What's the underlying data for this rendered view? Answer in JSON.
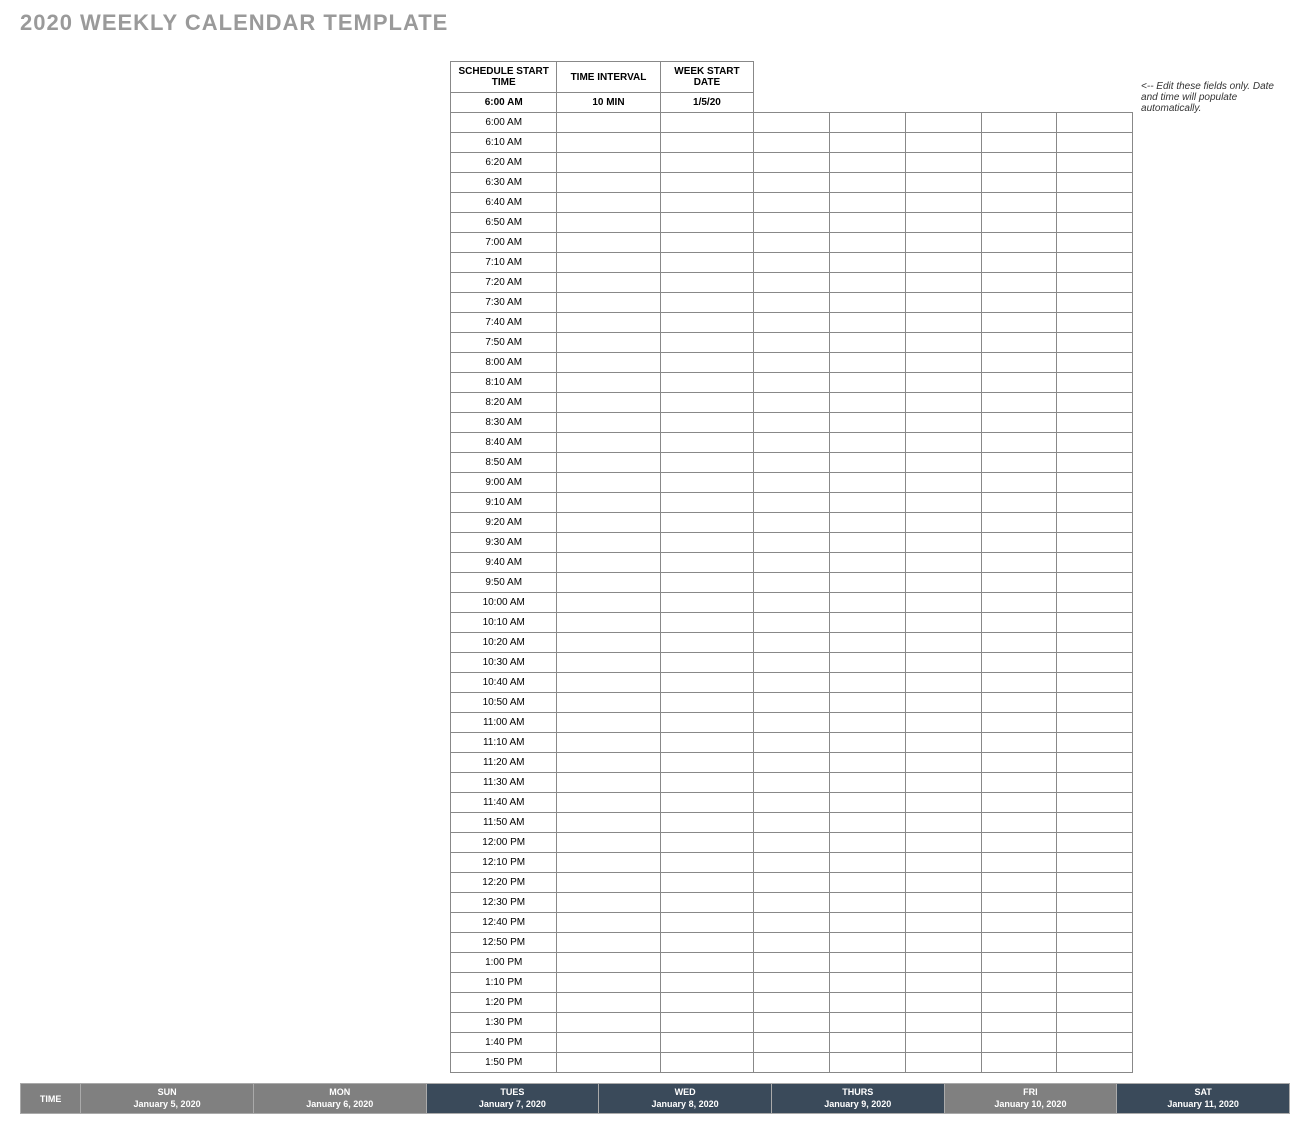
{
  "title": "2020 WEEKLY CALENDAR TEMPLATE",
  "config": {
    "headers": {
      "start": "SCHEDULE START TIME",
      "interval": "TIME INTERVAL",
      "week": "WEEK START DATE"
    },
    "values": {
      "start": "6:00 AM",
      "interval": "10 MIN",
      "week": "1/5/20"
    },
    "note": "<-- Edit these fields only. Date and time will populate automatically."
  },
  "columns": {
    "time": "TIME",
    "days": [
      {
        "name": "SUN",
        "date": "January 5, 2020",
        "gray": true
      },
      {
        "name": "MON",
        "date": "January 6, 2020",
        "gray": true
      },
      {
        "name": "TUES",
        "date": "January 7, 2020",
        "gray": false
      },
      {
        "name": "WED",
        "date": "January 8, 2020",
        "gray": false
      },
      {
        "name": "THURS",
        "date": "January 9, 2020",
        "gray": false
      },
      {
        "name": "FRI",
        "date": "January 10, 2020",
        "gray": true
      },
      {
        "name": "SAT",
        "date": "January 11, 2020",
        "gray": false
      }
    ]
  },
  "times": [
    "6:00 AM",
    "6:10 AM",
    "6:20 AM",
    "6:30 AM",
    "6:40 AM",
    "6:50 AM",
    "7:00 AM",
    "7:10 AM",
    "7:20 AM",
    "7:30 AM",
    "7:40 AM",
    "7:50 AM",
    "8:00 AM",
    "8:10 AM",
    "8:20 AM",
    "8:30 AM",
    "8:40 AM",
    "8:50 AM",
    "9:00 AM",
    "9:10 AM",
    "9:20 AM",
    "9:30 AM",
    "9:40 AM",
    "9:50 AM",
    "10:00 AM",
    "10:10 AM",
    "10:20 AM",
    "10:30 AM",
    "10:40 AM",
    "10:50 AM",
    "11:00 AM",
    "11:10 AM",
    "11:20 AM",
    "11:30 AM",
    "11:40 AM",
    "11:50 AM",
    "12:00 PM",
    "12:10 PM",
    "12:20 PM",
    "12:30 PM",
    "12:40 PM",
    "12:50 PM",
    "1:00 PM",
    "1:10 PM",
    "1:20 PM",
    "1:30 PM",
    "1:40 PM",
    "1:50 PM"
  ]
}
